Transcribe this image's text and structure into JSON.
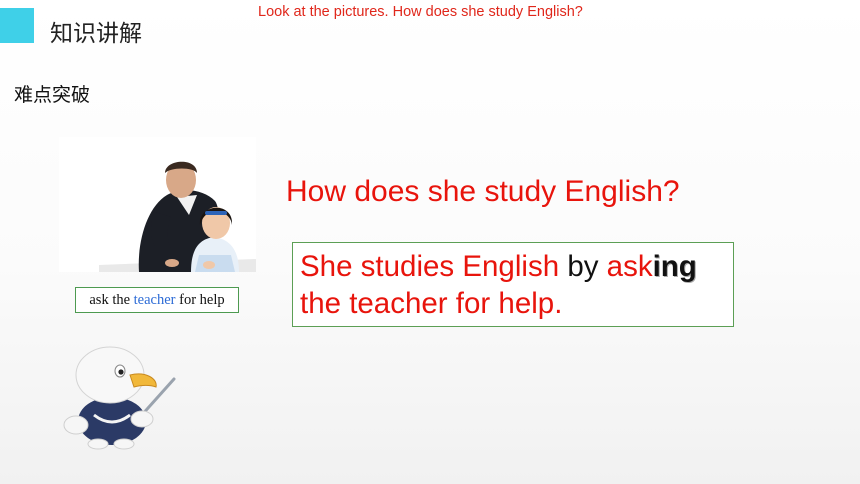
{
  "header": {
    "section_title": "知识讲解",
    "instruction": "Look at the pictures. How does she study English?",
    "accent_color": "#3fd0e8"
  },
  "sub_heading": "难点突破",
  "photo": {
    "caption_before": "ask the ",
    "caption_highlight": "teacher",
    "caption_after": " for help"
  },
  "question": "How does she study English?",
  "answer": {
    "part1": "She studies English ",
    "part2": "by ",
    "part3": "ask",
    "part4": "ing",
    "part5": "the teacher for help."
  },
  "colors": {
    "question_red": "#e8140c",
    "box_border": "#5c9f55",
    "highlight_blue": "#2c6bd6"
  },
  "icons": [
    "eagle-mascot-icon"
  ]
}
